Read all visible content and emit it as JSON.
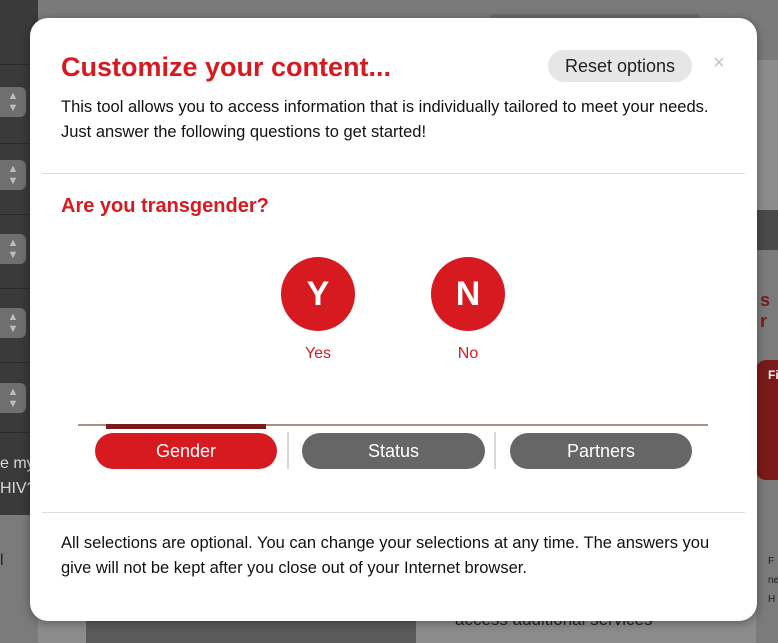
{
  "modal": {
    "title": "Customize your content...",
    "reset_label": "Reset options",
    "close_glyph": "×",
    "intro": "This tool allows you to access information that is individually tailored to meet your needs. Just answer the following questions to get started!",
    "question": "Are you transgender?",
    "choices": [
      {
        "letter": "Y",
        "label": "Yes"
      },
      {
        "letter": "N",
        "label": "No"
      }
    ],
    "steps": [
      {
        "label": "Gender",
        "active": true
      },
      {
        "label": "Status",
        "active": false
      },
      {
        "label": "Partners",
        "active": false
      }
    ],
    "footer": "All selections are optional. You can change your selections at any time. The answers you give will not be kept after you close out of your Internet browser."
  },
  "background": {
    "left_text_1": "e my",
    "left_text_2": "HIV?",
    "left_text_3": "l",
    "right_text_1": "s r",
    "right_text_2": "Fi",
    "right_small_1": "F",
    "right_small_2": "ne",
    "right_small_3": "H",
    "bottom_text": "access additional services"
  },
  "colors": {
    "accent": "#d71920",
    "inactive_step": "#666666",
    "progress_fill": "#7a1a1a"
  }
}
